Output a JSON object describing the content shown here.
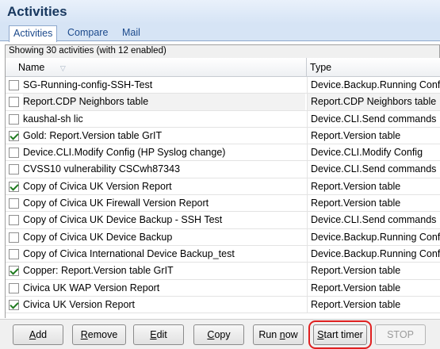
{
  "window": {
    "title": "Activities"
  },
  "tabs": [
    {
      "label": "Activities",
      "active": true
    },
    {
      "label": "Compare",
      "active": false
    },
    {
      "label": "Mail",
      "active": false
    }
  ],
  "status_text": "Showing 30 activities (with 12 enabled)",
  "columns": {
    "name": "Name",
    "type": "Type"
  },
  "rows": [
    {
      "checked": false,
      "name": "SG-Running-config-SSH-Test",
      "type": "Device.Backup.Running Config"
    },
    {
      "checked": false,
      "name": "Report.CDP Neighbors table",
      "type": "Report.CDP Neighbors table"
    },
    {
      "checked": false,
      "name": "kaushal-sh lic",
      "type": "Device.CLI.Send commands"
    },
    {
      "checked": true,
      "name": "Gold: Report.Version table GrIT",
      "type": "Report.Version table"
    },
    {
      "checked": false,
      "name": "Device.CLI.Modify Config (HP Syslog change)",
      "type": "Device.CLI.Modify Config"
    },
    {
      "checked": false,
      "name": "CVSS10 vulnerability CSCwh87343",
      "type": "Device.CLI.Send commands"
    },
    {
      "checked": true,
      "name": "Copy of Civica UK Version Report",
      "type": "Report.Version table"
    },
    {
      "checked": false,
      "name": "Copy of Civica UK Firewall Version Report",
      "type": "Report.Version table"
    },
    {
      "checked": false,
      "name": "Copy of Civica UK Device Backup - SSH Test",
      "type": "Device.CLI.Send commands"
    },
    {
      "checked": false,
      "name": "Copy of Civica UK Device Backup",
      "type": "Device.Backup.Running Config"
    },
    {
      "checked": false,
      "name": "Copy of Civica International Device Backup_test",
      "type": "Device.Backup.Running Config"
    },
    {
      "checked": true,
      "name": "Copper: Report.Version table GrIT",
      "type": "Report.Version table"
    },
    {
      "checked": false,
      "name": "Civica UK WAP Version Report",
      "type": "Report.Version table"
    },
    {
      "checked": true,
      "name": "Civica UK Version Report",
      "type": "Report.Version table"
    }
  ],
  "buttons": {
    "add": {
      "accel": "A",
      "rest": "dd"
    },
    "remove": {
      "accel": "R",
      "rest": "emove"
    },
    "edit": {
      "accel": "E",
      "rest": "dit"
    },
    "copy": {
      "accel": "C",
      "rest": "opy"
    },
    "run_now": {
      "pre": "Run ",
      "accel": "n",
      "rest": "ow"
    },
    "start_timer": {
      "accel": "S",
      "rest": "tart timer"
    },
    "stop": {
      "label": "STOP"
    }
  },
  "colors": {
    "title": "#17375e",
    "highlight": "#e02020",
    "check": "#1f7a1f"
  }
}
